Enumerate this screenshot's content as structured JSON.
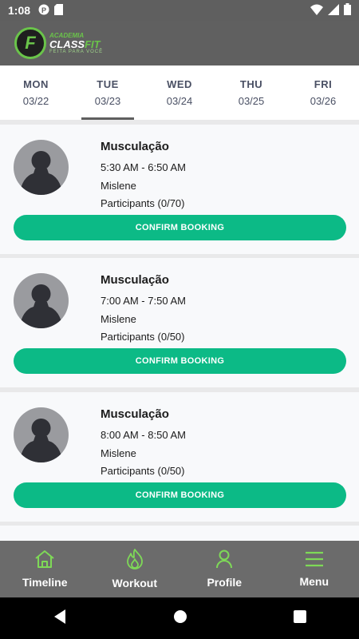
{
  "status_bar": {
    "time": "1:08"
  },
  "header": {
    "logo_letter": "F",
    "logo_small": "ACADEMIA",
    "logo_class": "CLASS",
    "logo_fit": "FIT",
    "logo_tag": "FEITA PARA VOCÊ"
  },
  "days": [
    {
      "name": "MON",
      "date": "03/22"
    },
    {
      "name": "TUE",
      "date": "03/23"
    },
    {
      "name": "WED",
      "date": "03/24"
    },
    {
      "name": "THU",
      "date": "03/25"
    },
    {
      "name": "FRI",
      "date": "03/26"
    }
  ],
  "classes": [
    {
      "title": "Musculação",
      "time": "5:30 AM - 6:50 AM",
      "instructor": "Mislene",
      "participants": "Participants (0/70)",
      "button": "CONFIRM BOOKING"
    },
    {
      "title": "Musculação",
      "time": "7:00 AM - 7:50 AM",
      "instructor": "Mislene",
      "participants": "Participants (0/50)",
      "button": "CONFIRM BOOKING"
    },
    {
      "title": "Musculação",
      "time": "8:00 AM - 8:50 AM",
      "instructor": "Mislene",
      "participants": "Participants (0/50)",
      "button": "CONFIRM BOOKING"
    }
  ],
  "nav": {
    "timeline": "Timeline",
    "workout": "Workout",
    "profile": "Profile",
    "menu": "Menu"
  },
  "colors": {
    "accent": "#0cba86",
    "nav_icon": "#7ed957",
    "header": "#606060"
  }
}
